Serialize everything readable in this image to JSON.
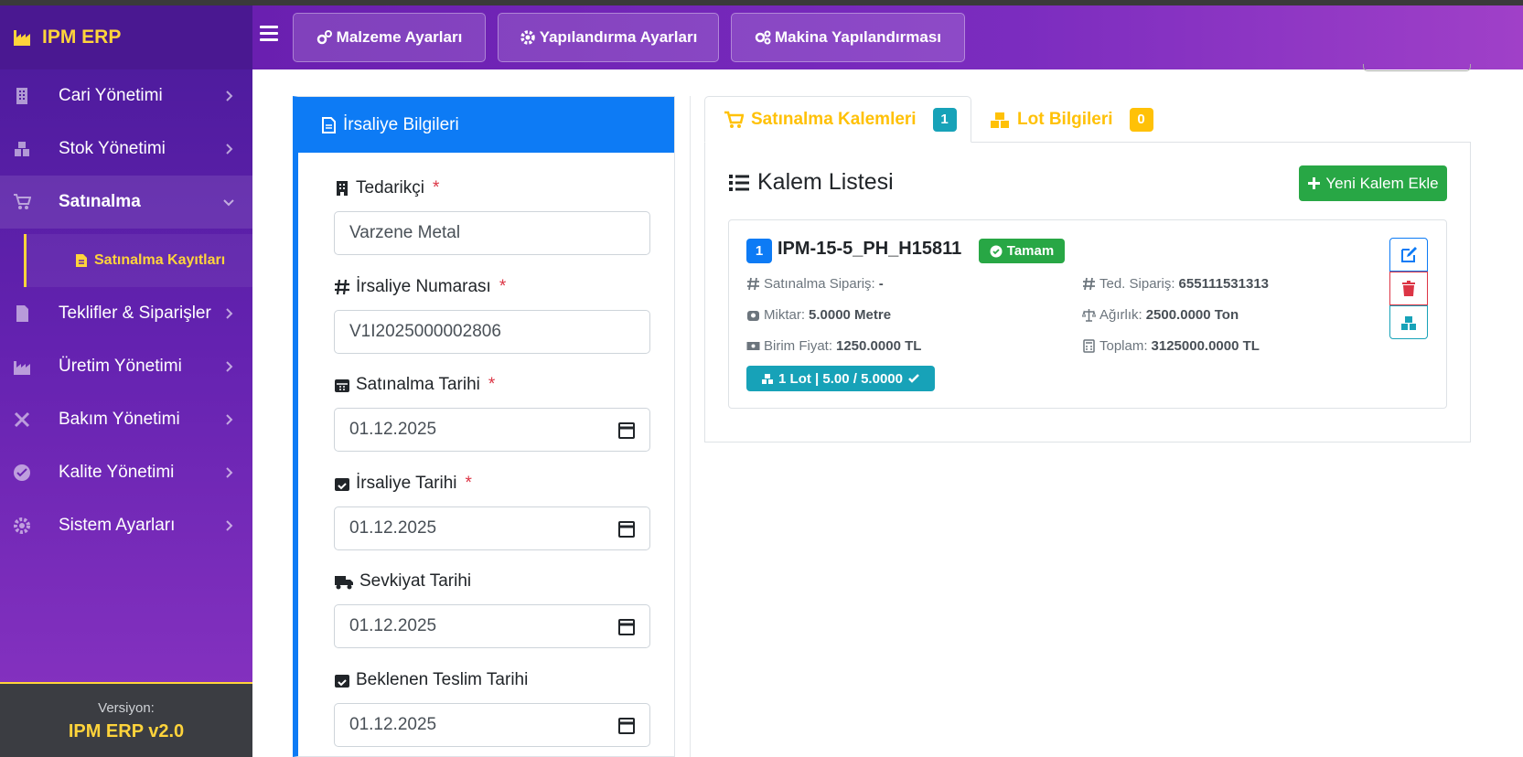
{
  "brand": {
    "name": "IPM ERP",
    "icon": "factory-icon"
  },
  "header": {
    "buttons": [
      {
        "label": "Malzeme Ayarları",
        "icon": "cogs-icon"
      },
      {
        "label": "Yapılandırma Ayarları",
        "icon": "cog-icon"
      },
      {
        "label": "Makina Yapılandırması",
        "icon": "cogs-icon"
      }
    ]
  },
  "sidebar": {
    "items": [
      {
        "label": "Cari Yönetimi",
        "icon": "building-icon"
      },
      {
        "label": "Stok Yönetimi",
        "icon": "boxes-icon"
      },
      {
        "label": "Satınalma",
        "icon": "cart-icon",
        "active": true
      },
      {
        "label": "Teklifler & Siparişler",
        "icon": "file-invoice-icon"
      },
      {
        "label": "Üretim Yönetimi",
        "icon": "industry-icon"
      },
      {
        "label": "Bakım Yönetimi",
        "icon": "tools-icon"
      },
      {
        "label": "Kalite Yönetimi",
        "icon": "check-circle-icon"
      },
      {
        "label": "Sistem Ayarları",
        "icon": "cog-icon"
      }
    ],
    "sub_item": {
      "label": "Satınalma Kayıtları",
      "icon": "file-icon"
    },
    "version_label": "Versiyon:",
    "version_value": "IPM ERP v2.0"
  },
  "form": {
    "title": "İrsaliye Bilgileri",
    "fields": [
      {
        "label": "Tedarikçi",
        "required": "*",
        "value": "Varzene Metal",
        "icon": "building-icon"
      },
      {
        "label": "İrsaliye Numarası",
        "required": "*",
        "value": "V1I2025000002806",
        "icon": "hashtag-icon"
      },
      {
        "label": "Satınalma Tarihi",
        "required": "*",
        "value": "01.12.2025",
        "icon": "calendar-icon"
      },
      {
        "label": "İrsaliye Tarihi",
        "required": "*",
        "value": "01.12.2025",
        "icon": "calendar-check-icon"
      },
      {
        "label": "Sevkiyat Tarihi",
        "required": "",
        "value": "01.12.2025",
        "icon": "truck-icon"
      },
      {
        "label": "Beklenen Teslim Tarihi",
        "required": "",
        "value": "01.12.2025",
        "icon": "calendar-check-icon"
      }
    ]
  },
  "tabs": [
    {
      "label": "Satınalma Kalemleri",
      "count": "1",
      "icon": "cart-icon"
    },
    {
      "label": "Lot Bilgileri",
      "count": "0",
      "icon": "boxes-icon"
    }
  ],
  "list": {
    "title": "Kalem Listesi",
    "add_label": "Yeni Kalem Ekle",
    "item": {
      "index": "1",
      "code": "IPM-15-5_PH_H15811",
      "status": "Tamam",
      "siparis_label": "Satınalma Sipariş:",
      "siparis_value": "-",
      "ted_label": "Ted. Sipariş:",
      "ted_value": "655111531313",
      "miktar_label": "Miktar:",
      "miktar_value": "5.0000 Metre",
      "agirlik_label": "Ağırlık:",
      "agirlik_value": "2500.0000 Ton",
      "fiyat_label": "Birim Fiyat:",
      "fiyat_value": "1250.0000 TL",
      "toplam_label": "Toplam:",
      "toplam_value": "3125000.0000 TL",
      "lot_text": "1 Lot | 5.00 / 5.0000"
    }
  },
  "colors": {
    "primary": "#0d7bf5",
    "accent": "#ffd43b",
    "success": "#28a745",
    "danger": "#dc3545",
    "info": "#17a2b8",
    "sidebar": "#6422b0"
  }
}
